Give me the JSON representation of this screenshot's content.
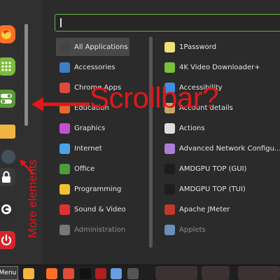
{
  "search": {
    "value": "",
    "placeholder": ""
  },
  "favorites": [
    "firefox-icon",
    "menu-grid-icon",
    "toggle-settings-icon",
    "folder-icon",
    "app-icon",
    "lock-icon",
    "logout-icon",
    "power-icon"
  ],
  "categories": [
    {
      "label": "All Applications",
      "icon": "grid-icon",
      "color": "#444444",
      "selected": true
    },
    {
      "label": "Accessories",
      "icon": "scissors-icon",
      "color": "#3d7fc4"
    },
    {
      "label": "Chrome Apps",
      "icon": "chrome-icon",
      "color": "#dd4b39"
    },
    {
      "label": "Education",
      "icon": "education-icon",
      "color": "#e56b2a"
    },
    {
      "label": "Graphics",
      "icon": "graphics-icon",
      "color": "#c44fd6"
    },
    {
      "label": "Internet",
      "icon": "cloud-icon",
      "color": "#4aa3e8"
    },
    {
      "label": "Office",
      "icon": "office-icon",
      "color": "#4c9c3a"
    },
    {
      "label": "Programming",
      "icon": "programming-icon",
      "color": "#f2c12e"
    },
    {
      "label": "Sound & Video",
      "icon": "play-icon",
      "color": "#e03131"
    },
    {
      "label": "Administration",
      "icon": "admin-icon",
      "color": "#777777",
      "dim": true
    }
  ],
  "apps": [
    {
      "label": "1Password",
      "icon": "onepassword-icon",
      "color": "#f2e07a"
    },
    {
      "label": "4K Video Downloader+",
      "icon": "download-icon",
      "color": "#7bbf3a"
    },
    {
      "label": "Accessibility",
      "icon": "accessibility-icon",
      "color": "#3d8ee0"
    },
    {
      "label": "Account details",
      "icon": "account-icon",
      "color": "#c9a36b"
    },
    {
      "label": "Actions",
      "icon": "actions-icon",
      "color": "#dddddd"
    },
    {
      "label": "Advanced Network Configu...",
      "icon": "network-icon",
      "color": "#a97fd6"
    },
    {
      "label": "AMDGPU TOP (GUI)",
      "icon": "terminal-icon",
      "color": "#1d1d1d"
    },
    {
      "label": "AMDGPU TOP (TUI)",
      "icon": "terminal-icon",
      "color": "#1d1d1d"
    },
    {
      "label": "Apache JMeter",
      "icon": "jmeter-icon",
      "color": "#c0392b"
    },
    {
      "label": "Applets",
      "icon": "applets-icon",
      "color": "#6a8fb8",
      "dim": true
    }
  ],
  "panel": {
    "menu_label": "Menu",
    "tasks": [
      {
        "icon": "folder-icon",
        "color": "#f2b440"
      },
      {
        "icon": "firefox-icon",
        "color": "#ff6f26"
      },
      {
        "icon": "chrome-icon",
        "color": "#dd4b39"
      },
      {
        "icon": "terminal-icon",
        "color": "#111111"
      },
      {
        "icon": "terminal-red-icon",
        "color": "#b02020"
      },
      {
        "icon": "folder-icon",
        "color": "#6a9de0"
      },
      {
        "icon": "camera-icon",
        "color": "#555555"
      }
    ]
  },
  "annotations": {
    "scrollbar": "Scrollbar?",
    "more": "More elements",
    "color": "#e0181b"
  }
}
